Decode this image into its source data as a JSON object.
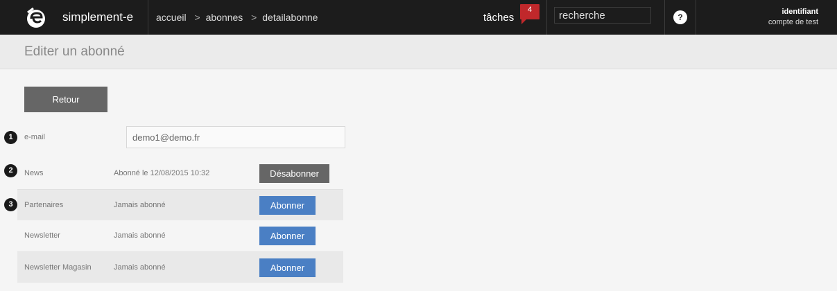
{
  "topbar": {
    "brand": "simplement-e",
    "breadcrumb": [
      "accueil",
      "abonnes",
      "detailabonne"
    ],
    "breadcrumb_separator": ">",
    "tasks_label": "tâches",
    "tasks_count": "4",
    "search_value": "recherche",
    "help_label": "?",
    "user_name": "identifiant",
    "user_account": "compte de test"
  },
  "page": {
    "title": "Editer un abonné"
  },
  "form": {
    "back_label": "Retour",
    "email_label": "e-mail",
    "email_value": "demo1@demo.fr",
    "markers": [
      "1",
      "2",
      "3"
    ]
  },
  "subscriptions": [
    {
      "name": "News",
      "status": "Abonné le 12/08/2015 10:32",
      "action": "Désabonner"
    },
    {
      "name": "Partenaires",
      "status": "Jamais abonné",
      "action": "Abonner"
    },
    {
      "name": "Newsletter",
      "status": "Jamais abonné",
      "action": "Abonner"
    },
    {
      "name": "Newsletter Magasin",
      "status": "Jamais abonné",
      "action": "Abonner"
    }
  ],
  "colors": {
    "topbar_bg": "#1c1c1c",
    "badge_red": "#c0282b",
    "subscribe_blue": "#4a7fc4",
    "unsubscribe_gray": "#666666"
  },
  "icons": {
    "logo": "simplement-e-logo",
    "help": "help-icon",
    "badge": "task-count-badge"
  }
}
